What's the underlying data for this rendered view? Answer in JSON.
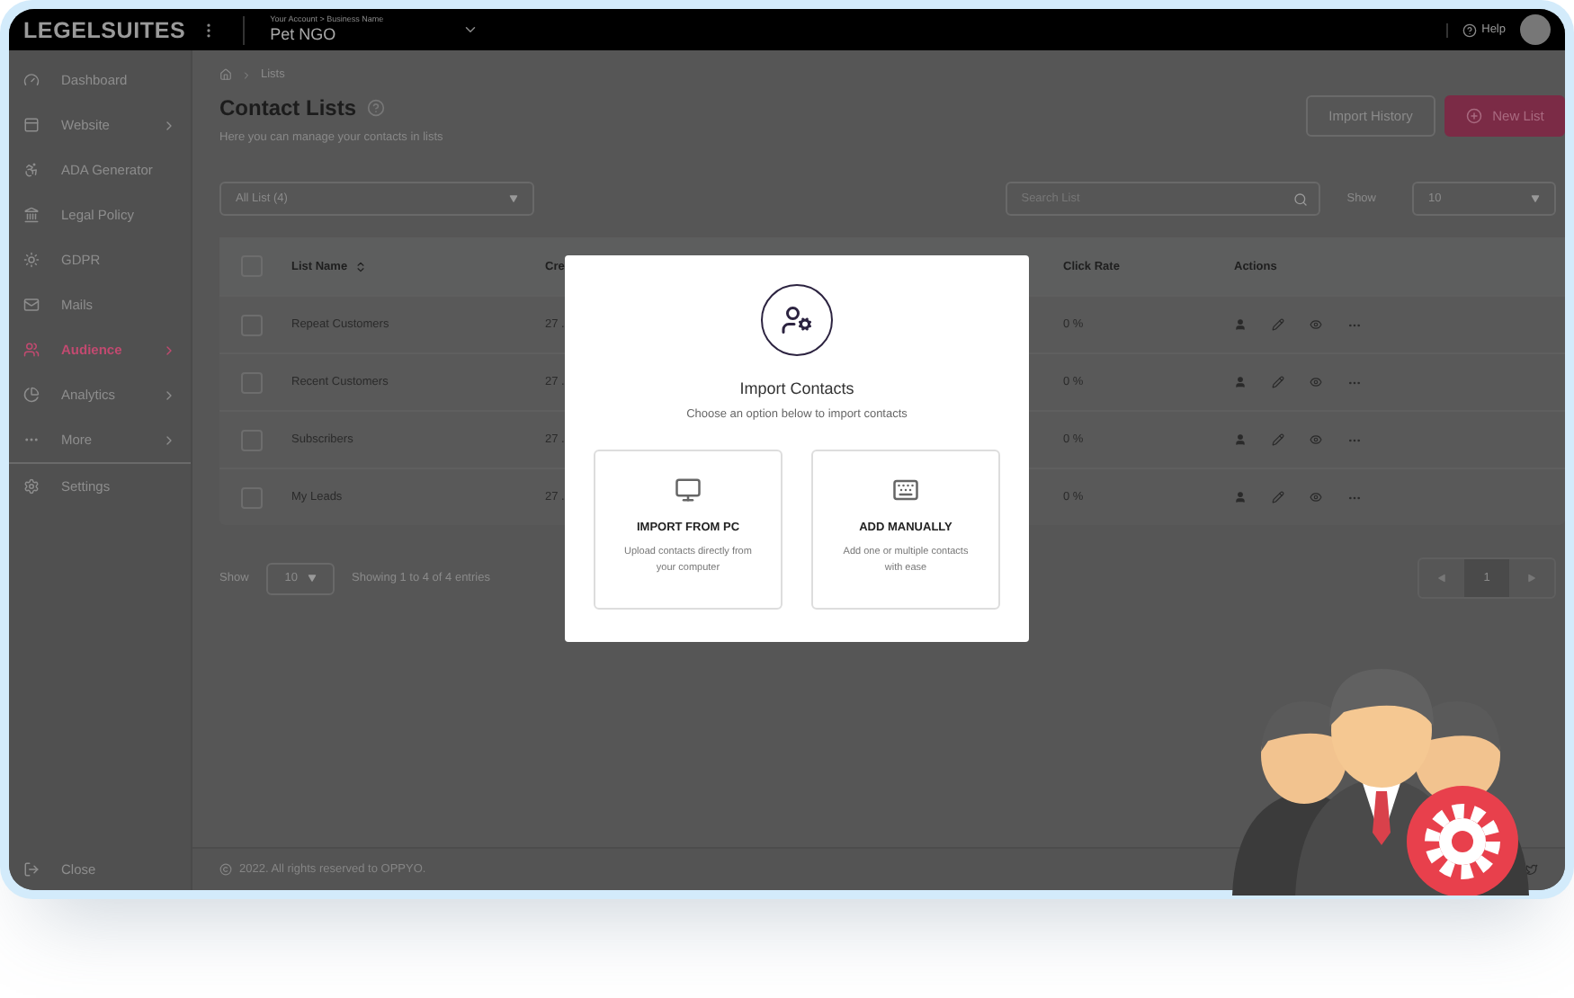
{
  "topbar": {
    "logo": "LEGELSUITES",
    "account_label": "Your Account > Business Name",
    "account_name": "Pet NGO",
    "help": "Help"
  },
  "sidebar": {
    "items": [
      {
        "label": "Dashboard",
        "submenu": false,
        "selected": false
      },
      {
        "label": "Website",
        "submenu": true,
        "selected": false
      },
      {
        "label": "ADA Generator",
        "submenu": false,
        "selected": false
      },
      {
        "label": "Legal Policy",
        "submenu": false,
        "selected": false
      },
      {
        "label": "GDPR",
        "submenu": false,
        "selected": false
      },
      {
        "label": "Mails",
        "submenu": false,
        "selected": false
      },
      {
        "label": "Audience",
        "submenu": true,
        "selected": true
      },
      {
        "label": "Analytics",
        "submenu": true,
        "selected": false
      },
      {
        "label": "More",
        "submenu": true,
        "selected": false
      },
      {
        "label": "Settings",
        "submenu": false,
        "selected": false
      }
    ],
    "close": "Close"
  },
  "breadcrumb": {
    "current": "Lists"
  },
  "page": {
    "title": "Contact Lists",
    "subtitle": "Here you can manage your contacts in lists",
    "buttons": [
      {
        "label": "Import History",
        "kind": "outline"
      },
      {
        "label": "New List",
        "kind": "primary"
      }
    ]
  },
  "filter": {
    "value": "All List (4)"
  },
  "search": {
    "placeholder": "Search List"
  },
  "show": {
    "label": "Show",
    "value": "10"
  },
  "table": {
    "header_checked": false,
    "columns": [
      "List Name",
      "Cre",
      "Click Rate",
      "Actions"
    ],
    "rows": [
      {
        "checked": false,
        "name": "Repeat Customers",
        "column_3": "27 .",
        "click_rate": "0 %"
      },
      {
        "checked": false,
        "name": "Recent Customers",
        "column_3": "27 .",
        "click_rate": "0 %"
      },
      {
        "checked": false,
        "name": "Subscribers",
        "column_3": "27 .",
        "click_rate": "0 %"
      },
      {
        "checked": false,
        "name": "My Leads",
        "column_3": "27 .",
        "click_rate": "0 %"
      }
    ]
  },
  "pagination": {
    "label": "Show",
    "per_page": "10",
    "summary": "Showing 1 to 4 of 4 entries",
    "pages": [
      {
        "label": "1",
        "selected": true
      }
    ]
  },
  "footer": {
    "copyright": "2022. All rights reserved to OPPYO."
  },
  "modal": {
    "title": "Import Contacts",
    "subtitle": "Choose an option below to import contacts",
    "options": [
      {
        "kind": "pc",
        "title": "IMPORT FROM PC",
        "description": "Upload contacts directly from your computer"
      },
      {
        "kind": "manual",
        "title": "ADD MANUALLY",
        "description": "Add one or multiple contacts with ease"
      }
    ]
  }
}
